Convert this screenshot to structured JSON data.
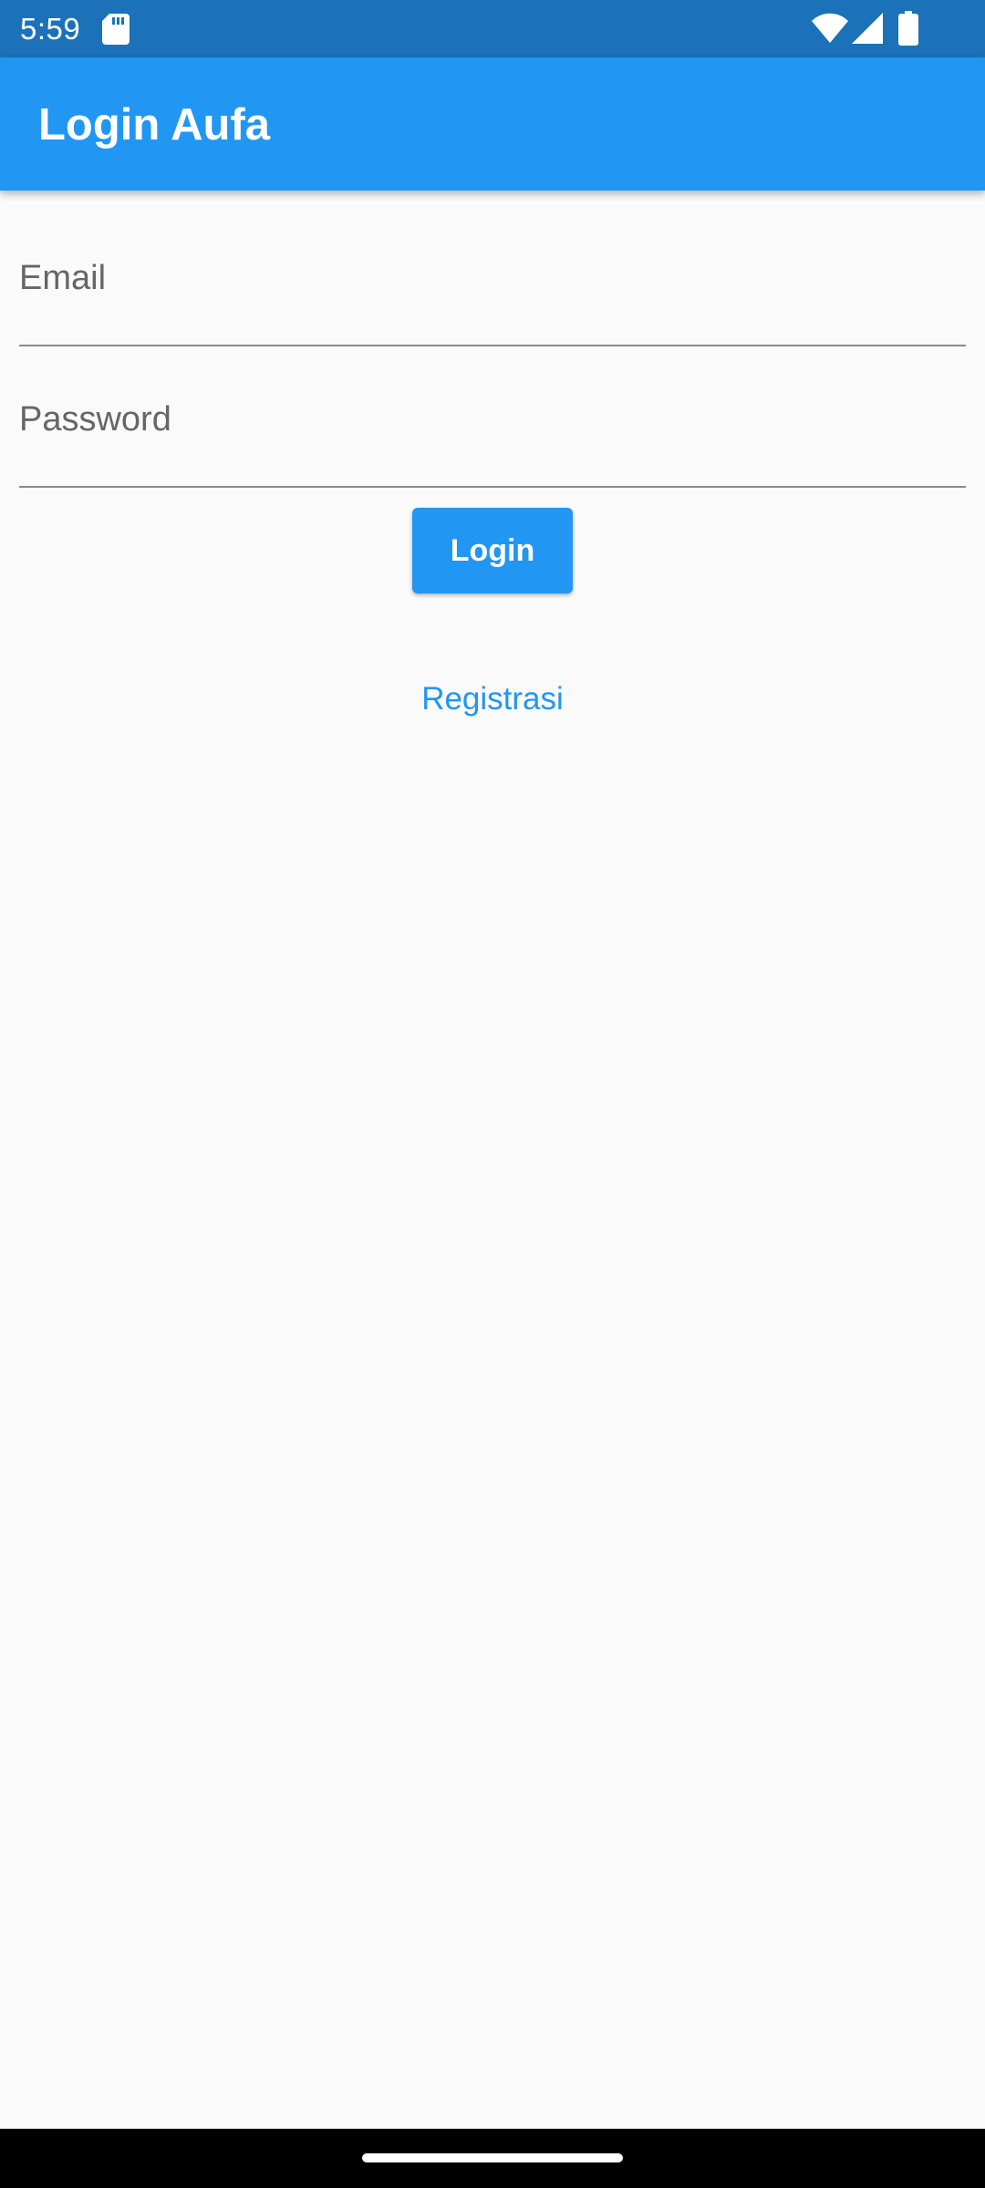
{
  "status_bar": {
    "time": "5:59",
    "icons": [
      "sd-card-icon",
      "wifi-icon",
      "signal-icon",
      "battery-icon"
    ]
  },
  "app_bar": {
    "title": "Login Aufa"
  },
  "form": {
    "email": {
      "label": "Email",
      "value": ""
    },
    "password": {
      "label": "Password",
      "value": ""
    },
    "login_button": "Login",
    "register_link": "Registrasi"
  },
  "colors": {
    "primary": "#2196f3",
    "status_bar": "#1b72b8",
    "background": "#fafafa",
    "label": "#666666"
  }
}
